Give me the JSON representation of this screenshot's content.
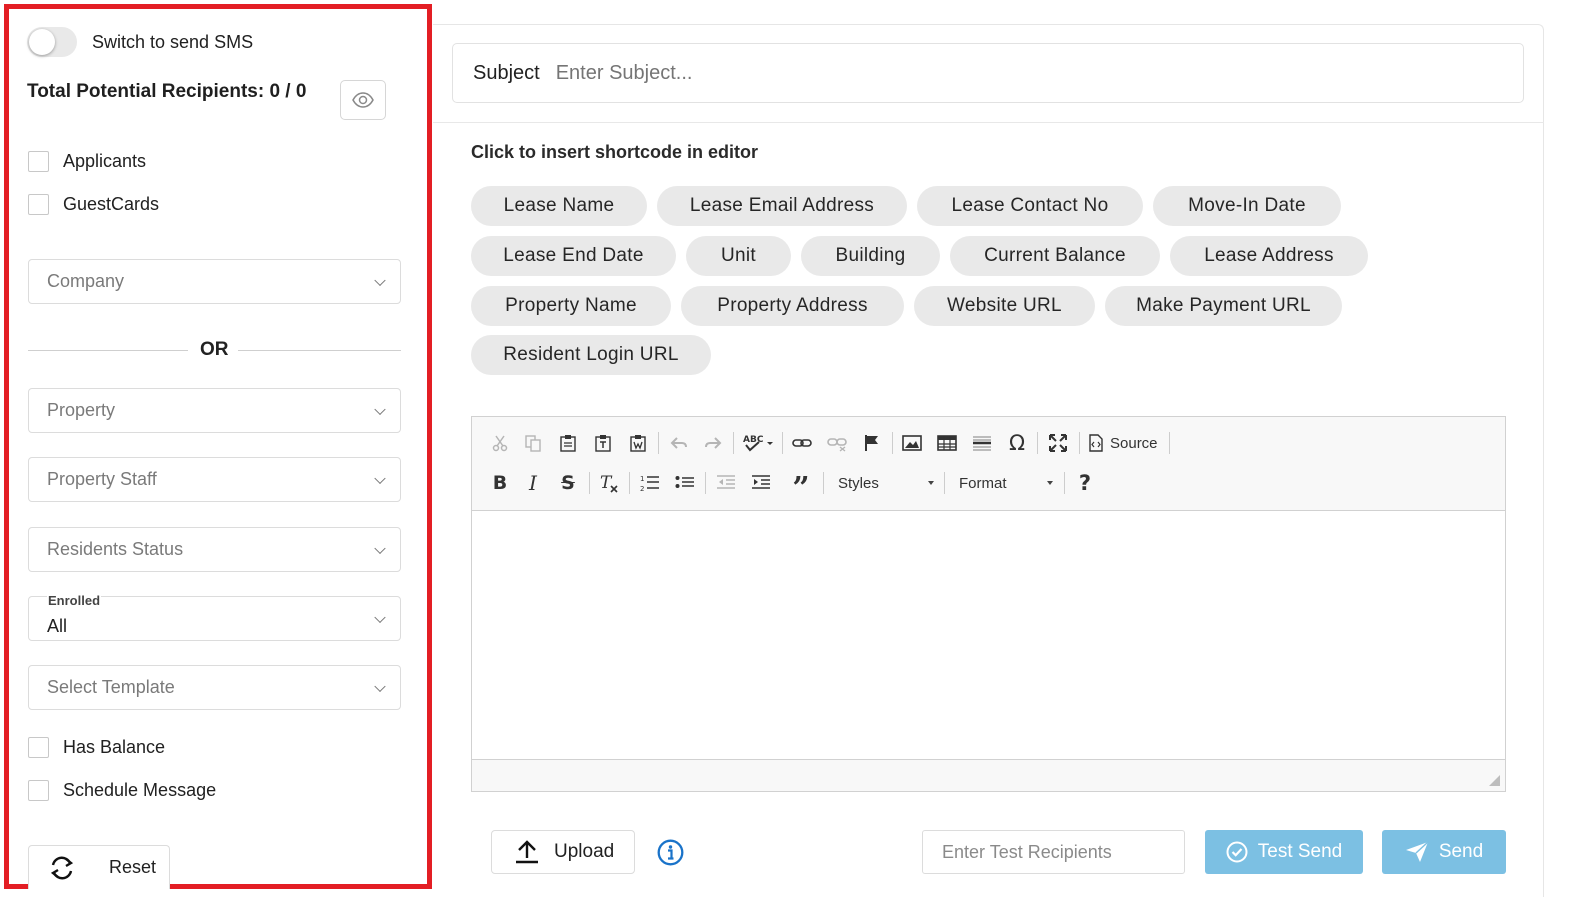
{
  "sidebar": {
    "sms_toggle_label": "Switch to send SMS",
    "recipients_label": "Total Potential Recipients: 0 / 0",
    "checkboxes_top": [
      {
        "label": "Applicants"
      },
      {
        "label": "GuestCards"
      }
    ],
    "company_placeholder": "Company",
    "or_text": "OR",
    "property_placeholder": "Property",
    "property_staff_placeholder": "Property Staff",
    "residents_status_placeholder": "Residents Status",
    "enrolled_label": "Enrolled",
    "enrolled_value": "All",
    "template_placeholder": "Select Template",
    "checkboxes_bottom": [
      {
        "label": "Has Balance"
      },
      {
        "label": "Schedule Message"
      }
    ],
    "reset_label": "Reset"
  },
  "main": {
    "subject_label": "Subject",
    "subject_placeholder": "Enter Subject...",
    "shortcode_title": "Click to insert shortcode in editor",
    "shortcodes": [
      "Lease Name",
      "Lease Email Address",
      "Lease Contact No",
      "Move-In Date",
      "Lease End Date",
      "Unit",
      "Building",
      "Current Balance",
      "Lease Address",
      "Property Name",
      "Property Address",
      "Website URL",
      "Make Payment URL",
      "Resident Login URL"
    ],
    "editor": {
      "source_label": "Source",
      "styles_label": "Styles",
      "format_label": "Format",
      "help_label": "?"
    },
    "footer": {
      "upload_label": "Upload",
      "test_recipients_placeholder": "Enter Test Recipients",
      "test_send_label": "Test Send",
      "send_label": "Send"
    }
  },
  "colors": {
    "highlight_border": "#e31e24",
    "accent_blue": "#7cc0e3",
    "info_blue": "#1a73c9",
    "chip_bg": "#e9e9e9"
  }
}
